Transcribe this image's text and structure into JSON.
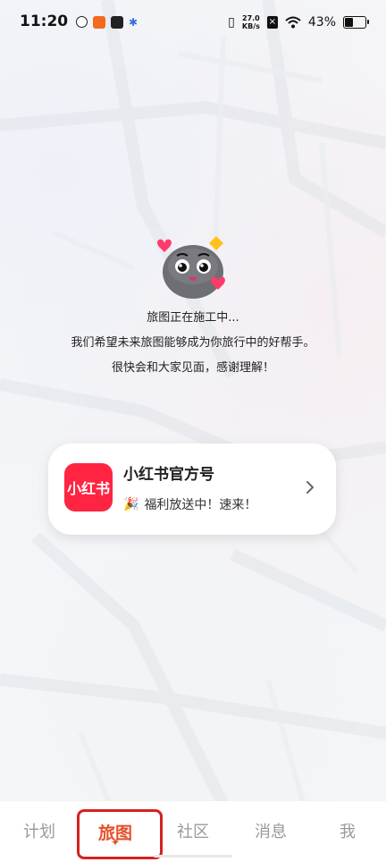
{
  "status_bar": {
    "time": "11:20",
    "net_speed_value": "27.0",
    "net_speed_unit": "KB/s",
    "battery": "43%"
  },
  "main": {
    "line1": "旅图正在施工中...",
    "line2": "我们希望未来旅图能够成为你旅行中的好帮手。",
    "line3": "很快会和大家见面，感谢理解！"
  },
  "card": {
    "logo_text": "小红书",
    "title": "小红书官方号",
    "subtitle": "福利放送中！速来！",
    "emoji": "🎉"
  },
  "nav": {
    "items": [
      "计划",
      "旅图",
      "社区",
      "消息",
      "我"
    ],
    "active": "旅图"
  },
  "colors": {
    "brand": "#ff2442",
    "active_tab": "#e4502a",
    "highlight": "#d52222"
  }
}
